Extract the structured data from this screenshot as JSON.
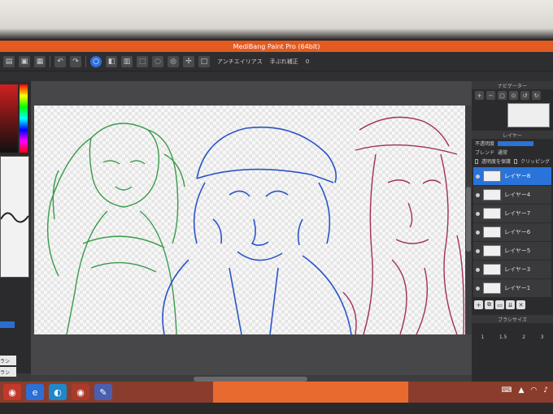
{
  "window": {
    "title": "MediBang Paint Pro (64bit)"
  },
  "toolbar": {
    "antialias_label": "アンチエイリアス",
    "stabilizer_label": "手ぶれ補正",
    "stabilizer_value": "0"
  },
  "navigator": {
    "title": "ナビゲーター"
  },
  "layer_panel": {
    "title": "レイヤー",
    "opacity_label": "不透明度",
    "blend_label": "ブレンド",
    "blend_value": "通常",
    "protect_alpha_label": "透明度を保護",
    "clipping_label": "クリッピング",
    "layers": [
      {
        "name": "レイヤー8",
        "selected": true
      },
      {
        "name": "レイヤー4",
        "selected": false
      },
      {
        "name": "レイヤー7",
        "selected": false
      },
      {
        "name": "レイヤー6",
        "selected": false
      },
      {
        "name": "レイヤー5",
        "selected": false
      },
      {
        "name": "レイヤー3",
        "selected": false
      },
      {
        "name": "レイヤー1",
        "selected": false
      }
    ]
  },
  "brush_size_panel": {
    "title": "ブラシサイズ",
    "sizes": [
      "1",
      "1.5",
      "2",
      "3"
    ]
  },
  "left_panel": {
    "items": [
      "ラン",
      "ラン",
      "ントロー"
    ]
  },
  "colors": {
    "titlebar": "#e35b21",
    "selected_layer": "#2a73d8",
    "taskbar": "#8a3d2c"
  },
  "taskbar": {
    "icons": [
      "chrome-icon",
      "edge-icon",
      "edge-icon",
      "chrome-icon",
      "medibang-icon"
    ]
  }
}
